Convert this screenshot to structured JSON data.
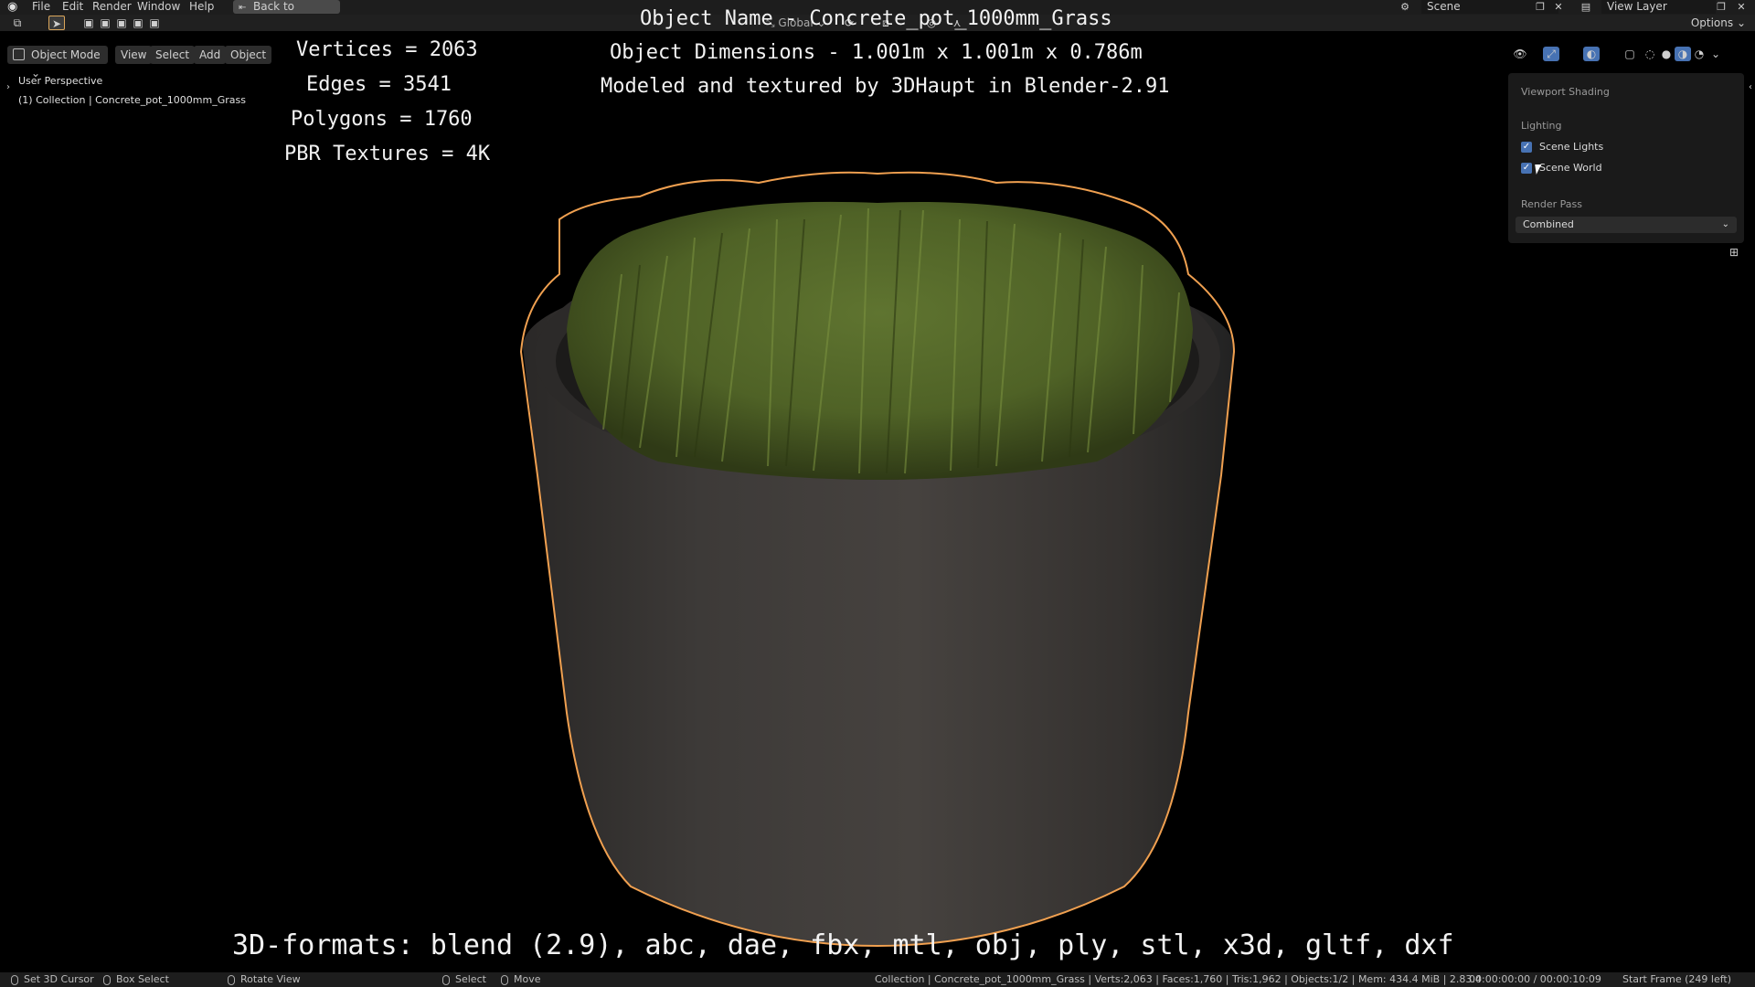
{
  "menubar": {
    "items": [
      "File",
      "Edit",
      "Render",
      "Window",
      "Help"
    ],
    "back_button": "Back to Previous",
    "scene": "Scene",
    "view_layer": "View Layer"
  },
  "toolbar": {
    "transform_orientation": "Global",
    "options": "Options"
  },
  "viewport_header": {
    "mode": "Object Mode",
    "menus": [
      "View",
      "Select",
      "Add",
      "Object"
    ]
  },
  "viewport_info": {
    "perspective": "User Perspective",
    "collection": "(1) Collection | Concrete_pot_1000mm_Grass"
  },
  "overlay": {
    "vertices": "Vertices = 2063",
    "edges": "Edges = 3541",
    "polygons": "Polygons = 1760",
    "textures": "PBR Textures = 4K",
    "object_name": "Object Name - Concrete_pot_1000mm_Grass",
    "dimensions": "Object Dimensions -  1.001m x 1.001m x 0.786m",
    "credits": "Modeled and textured by 3DHaupt in Blender-2.91",
    "formats": "3D-formats: blend (2.9), abc, dae, fbx, mtl, obj, ply, stl, x3d, gltf, dxf"
  },
  "shading_panel": {
    "title": "Viewport Shading",
    "lighting_label": "Lighting",
    "scene_lights": "Scene Lights",
    "scene_world": "Scene World",
    "render_pass_label": "Render Pass",
    "render_pass_value": "Combined"
  },
  "statusbar": {
    "set_cursor": "Set 3D Cursor",
    "box_select": "Box Select",
    "rotate_view": "Rotate View",
    "select": "Select",
    "move": "Move",
    "stats": "Collection | Concrete_pot_1000mm_Grass | Verts:2,063 | Faces:1,760 | Tris:1,962 | Objects:1/2 | Mem: 434.4 MiB | 2.83.4",
    "time": "00:00:00:00 / 00:00:10:09",
    "start_frame": "Start Frame (249 left)"
  },
  "colors": {
    "outline": "#f0a050",
    "checkbox": "#4772b3",
    "grass": "#5a6e2a",
    "concrete": "#3f3c3a"
  }
}
